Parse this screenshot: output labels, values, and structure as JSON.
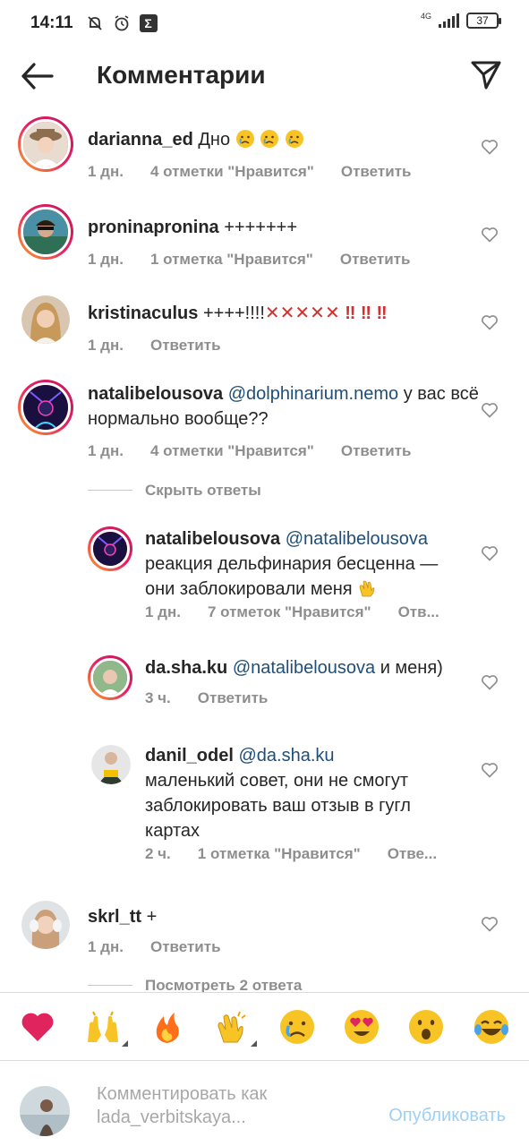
{
  "status_bar": {
    "time": "14:11",
    "network": "4G",
    "battery": "37"
  },
  "header": {
    "title": "Комментарии"
  },
  "comments": [
    {
      "username": "darianna_ed",
      "text": "Дно",
      "emoji": "crying-face",
      "time": "1 дн.",
      "likes": "4 отметки \"Нравится\"",
      "reply": "Ответить"
    },
    {
      "username": "proninapronina",
      "text": "+++++++",
      "time": "1 дн.",
      "likes": "1 отметка \"Нравится\"",
      "reply": "Ответить"
    },
    {
      "username": "kristinaculus",
      "text": "++++!!!!",
      "crosses": "✕✕✕✕✕",
      "bangs": "‼ ‼ ‼",
      "time": "1 дн.",
      "reply": "Ответить"
    },
    {
      "username": "natalibelousova",
      "mention": "@dolphinarium.nemo",
      "text": "у вас всё нормально вообще??",
      "time": "1 дн.",
      "likes": "4 отметки \"Нравится\"",
      "reply": "Ответить"
    }
  ],
  "hide_replies": "Скрыть ответы",
  "replies": [
    {
      "username": "natalibelousova",
      "mention": "@natalibelousova",
      "text": "реакция дельфинария бесценна — они заблокировали меня",
      "emoji": "clapping-hands",
      "time": "1 дн.",
      "likes": "7 отметок \"Нравится\"",
      "reply": "Отв..."
    },
    {
      "username": "da.sha.ku",
      "mention": "@natalibelousova",
      "text": "и меня)",
      "time": "3 ч.",
      "reply": "Ответить"
    },
    {
      "username": "danil_odel",
      "mention": "@da.sha.ku",
      "text": "маленький совет, они не смогут заблокировать ваш отзыв в гугл картах",
      "time": "2 ч.",
      "likes": "1 отметка \"Нравится\"",
      "reply": "Отве..."
    }
  ],
  "comment_last": {
    "username": "skrl_tt",
    "text": "+",
    "time": "1 дн.",
    "reply": "Ответить"
  },
  "view_replies": "Посмотреть 2 ответа",
  "reactions": [
    "red-heart",
    "raising-hands",
    "fire",
    "clapping-hands",
    "crying-face",
    "heart-eyes",
    "surprised-face",
    "tears-of-joy"
  ],
  "compose": {
    "placeholder": "Комментировать как lada_verbitskaya...",
    "publish": "Опубликовать"
  }
}
